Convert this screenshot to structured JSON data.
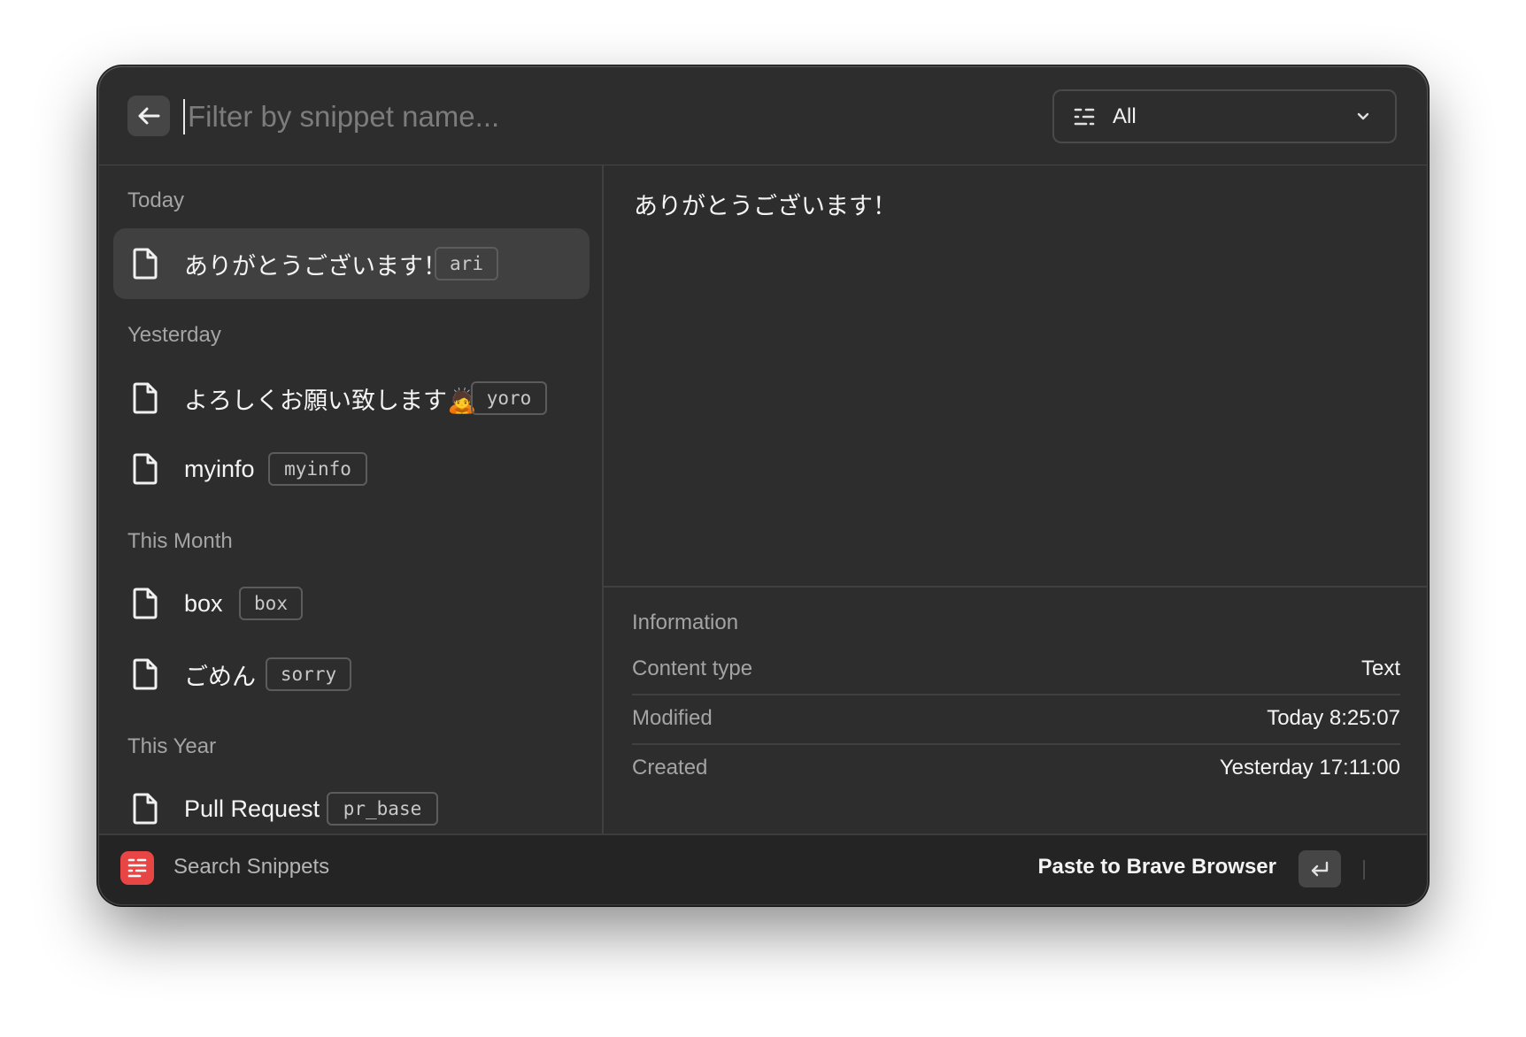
{
  "search": {
    "placeholder": "Filter by snippet name..."
  },
  "filter": {
    "selected": "All"
  },
  "sections": {
    "today": "Today",
    "yesterday": "Yesterday",
    "this_month": "This Month",
    "this_year": "This Year"
  },
  "snippets": [
    {
      "name": "ありがとうございます！",
      "keyword": "ari"
    },
    {
      "name": "よろしくお願い致します🙇",
      "keyword": "yoro"
    },
    {
      "name": "myinfo",
      "keyword": "myinfo"
    },
    {
      "name": "box",
      "keyword": "box"
    },
    {
      "name": "ごめん",
      "keyword": "sorry"
    },
    {
      "name": "Pull Request",
      "keyword": "pr_base"
    }
  ],
  "preview": {
    "text": "ありがとうございます！"
  },
  "information": {
    "title": "Information",
    "rows": [
      {
        "label": "Content type",
        "value": "Text"
      },
      {
        "label": "Modified",
        "value": "Today 8:25:07"
      },
      {
        "label": "Created",
        "value": "Yesterday 17:11:00"
      }
    ]
  },
  "footer": {
    "app_name": "Search Snippets",
    "primary_action": "Paste to Brave Browser",
    "accent_color": "#e84545"
  }
}
